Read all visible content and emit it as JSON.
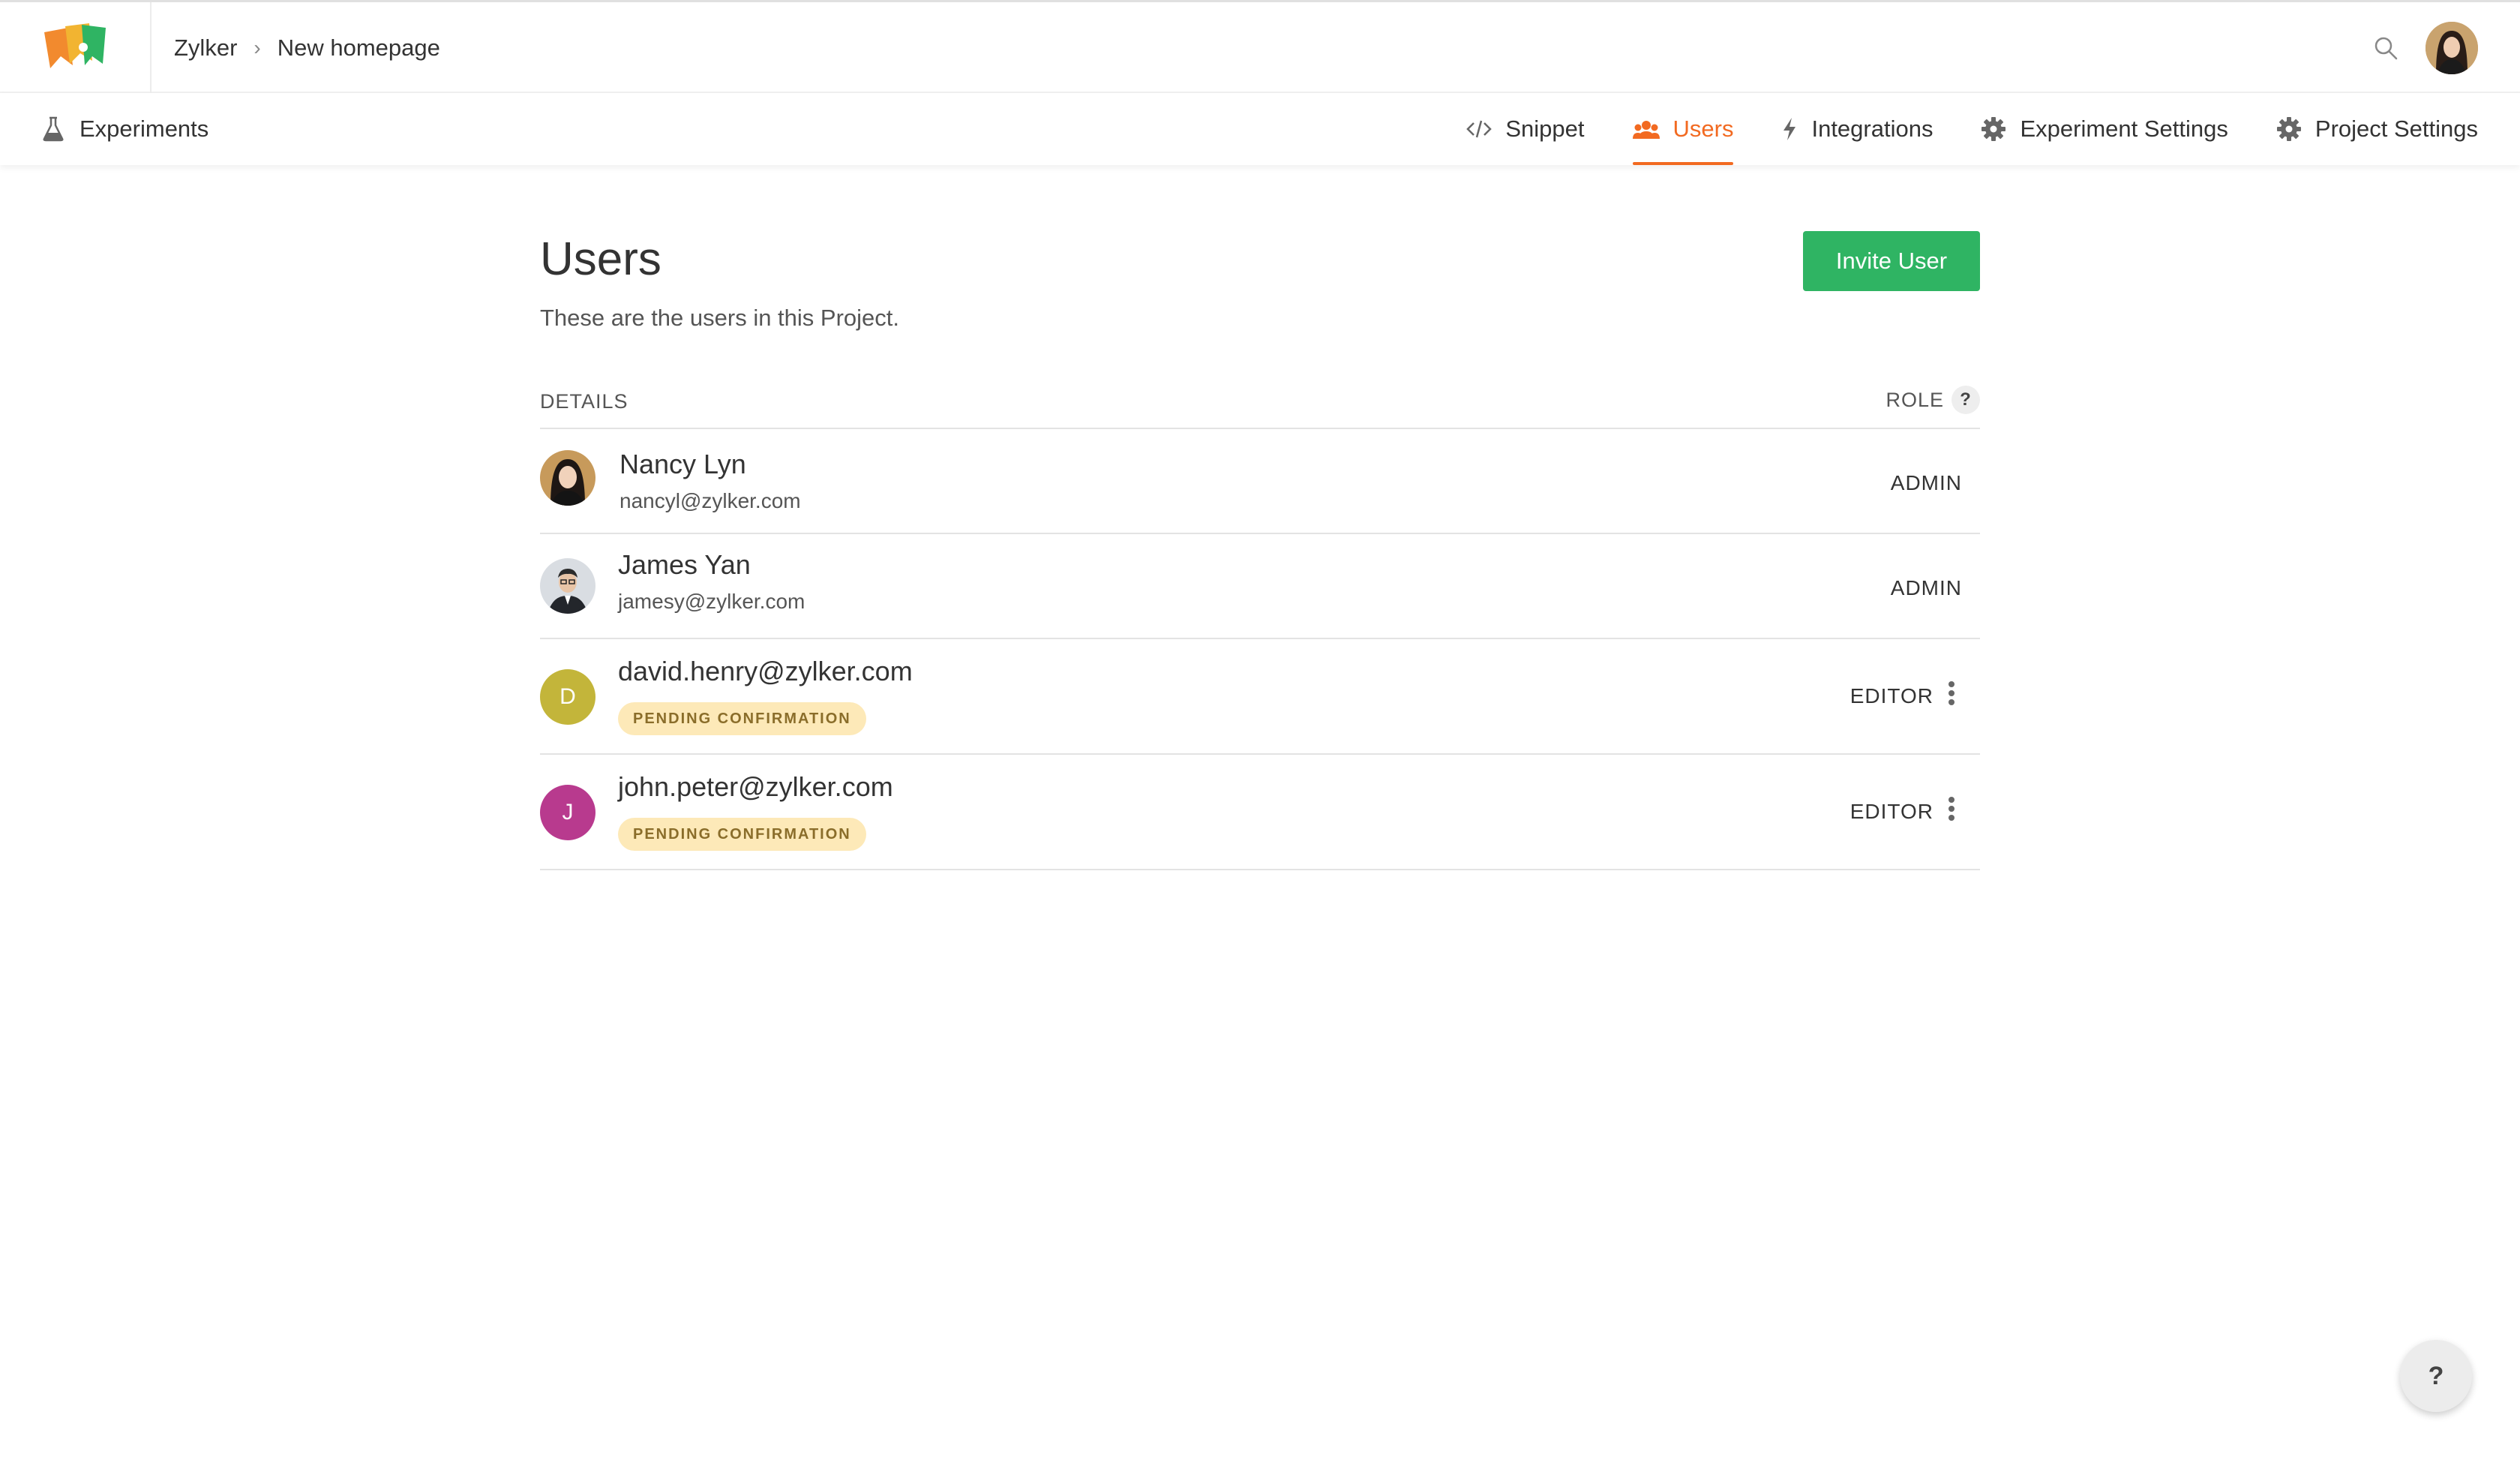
{
  "breadcrumb": {
    "org": "Zylker",
    "separator": "›",
    "project": "New homepage"
  },
  "subnav": {
    "experiments_label": "Experiments",
    "tabs": [
      {
        "label": "Snippet",
        "icon": "code-icon"
      },
      {
        "label": "Users",
        "icon": "users-icon",
        "active": true
      },
      {
        "label": "Integrations",
        "icon": "lightning-icon"
      },
      {
        "label": "Experiment Settings",
        "icon": "gear-icon"
      },
      {
        "label": "Project Settings",
        "icon": "gear-icon"
      }
    ]
  },
  "page": {
    "title": "Users",
    "subtitle": "These are the users in this Project.",
    "invite_label": "Invite User"
  },
  "table": {
    "col_details": "DETAILS",
    "col_role": "ROLE",
    "role_help": "?",
    "rows": [
      {
        "name": "Nancy Lyn",
        "email": "nancyl@zylker.com",
        "role": "ADMIN"
      },
      {
        "name": "James Yan",
        "email": "jamesy@zylker.com",
        "role": "ADMIN"
      },
      {
        "name": "david.henry@zylker.com",
        "initial": "D",
        "badge": "PENDING CONFIRMATION",
        "role": "EDITOR"
      },
      {
        "name": "john.peter@zylker.com",
        "initial": "J",
        "badge": "PENDING CONFIRMATION",
        "role": "EDITOR"
      }
    ]
  },
  "help_fab": "?",
  "colors": {
    "accent": "#f26a21",
    "primary_button": "#2fb463",
    "badge_bg": "#fde9b8",
    "avatar_d": "#c3b53a",
    "avatar_j": "#b83a8e"
  }
}
